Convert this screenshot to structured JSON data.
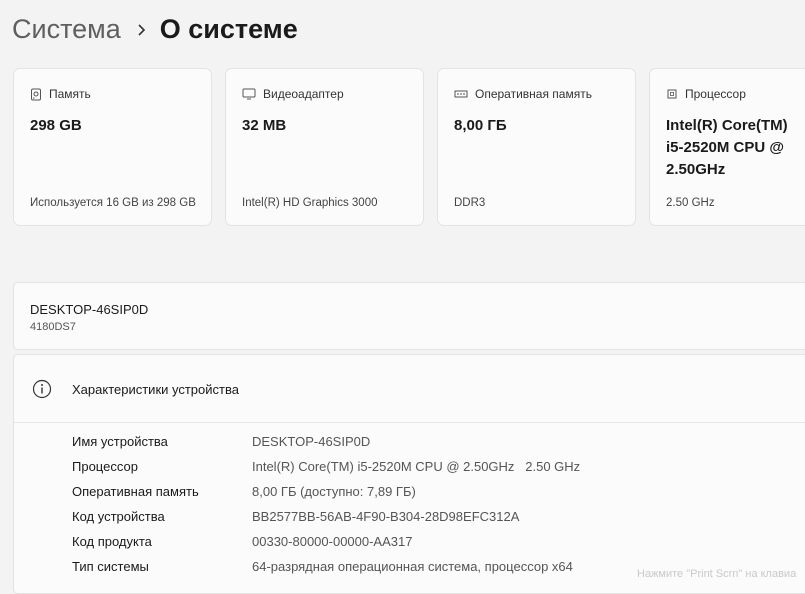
{
  "breadcrumb": {
    "parent": "Система",
    "current": "О системе"
  },
  "cards": [
    {
      "icon": "storage-icon",
      "title": "Память",
      "value": "298 GB",
      "sub": "Используется 16 GB из 298 GB"
    },
    {
      "icon": "monitor-icon",
      "title": "Видеоадаптер",
      "value": "32 MB",
      "sub": "Intel(R) HD Graphics 3000"
    },
    {
      "icon": "ram-icon",
      "title": "Оперативная память",
      "value": "8,00 ГБ",
      "sub": "DDR3"
    },
    {
      "icon": "processor-icon",
      "title": "Процессор",
      "value": "Intel(R) Core(TM) i5-2520M CPU @ 2.50GHz",
      "sub": "2.50 GHz"
    }
  ],
  "device": {
    "name": "DESKTOP-46SIP0D",
    "model": "4180DS7"
  },
  "specs": {
    "icon": "info-icon",
    "title": "Характеристики устройства",
    "rows": [
      {
        "label": "Имя устройства",
        "value": "DESKTOP-46SIP0D"
      },
      {
        "label": "Процессор",
        "value": "Intel(R) Core(TM) i5-2520M CPU @ 2.50GHz   2.50 GHz"
      },
      {
        "label": "Оперативная память",
        "value": "8,00 ГБ (доступно: 7,89 ГБ)"
      },
      {
        "label": "Код устройства",
        "value": "BB2577BB-56AB-4F90-B304-28D98EFC312A"
      },
      {
        "label": "Код продукта",
        "value": "00330-80000-00000-AA317"
      },
      {
        "label": "Тип системы",
        "value": "64-разрядная операционная система, процессор x64"
      }
    ]
  },
  "watermark": "Нажмите \"Print Scrn\" на клавиа"
}
